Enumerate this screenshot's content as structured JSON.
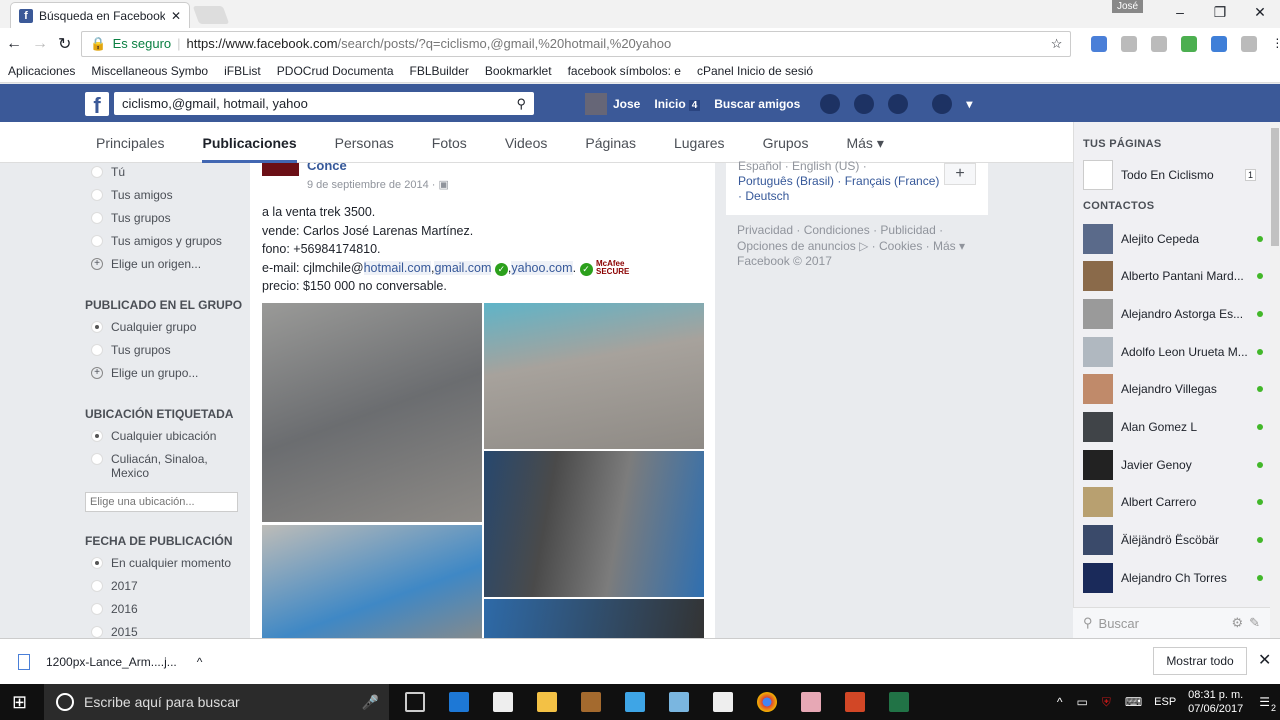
{
  "browser": {
    "tab_title": "Búsqueda en Facebook: c",
    "user": "José",
    "secure_label": "Es seguro",
    "url_host": "https://www.facebook.com",
    "url_path": "/search/posts/?q=ciclismo,@gmail,%20hotmail,%20yahoo",
    "bookmarks": [
      "Aplicaciones",
      "Miscellaneous Symbo",
      "iFBList",
      "PDOCrud Documenta",
      "FBLBuilder",
      "Bookmarklet",
      "facebook símbolos: e",
      "cPanel Inicio de sesió"
    ]
  },
  "fb": {
    "search_value": "ciclismo,@gmail, hotmail, yahoo",
    "user": "Jose",
    "home": "Inicio",
    "home_count": "4",
    "find_friends": "Buscar amigos"
  },
  "tabs": [
    "Principales",
    "Publicaciones",
    "Personas",
    "Fotos",
    "Videos",
    "Páginas",
    "Lugares",
    "Grupos",
    "Más ▾"
  ],
  "filters": {
    "origin_opts": [
      "Tú",
      "Tus amigos",
      "Tus grupos",
      "Tus amigos y grupos"
    ],
    "origin_choose": "Elige un origen...",
    "group_title": "PUBLICADO EN EL GRUPO",
    "group_opts": [
      "Cualquier grupo",
      "Tus grupos"
    ],
    "group_choose": "Elige un grupo...",
    "loc_title": "UBICACIÓN ETIQUETADA",
    "loc_opts": [
      "Cualquier ubicación",
      "Culiacán, Sinaloa, Mexico"
    ],
    "loc_placeholder": "Elige una ubicación...",
    "date_title": "FECHA DE PUBLICACIÓN",
    "date_opts": [
      "En cualquier momento",
      "2017",
      "2016",
      "2015"
    ]
  },
  "post": {
    "author": "Conce",
    "date": "9 de septiembre de 2014 ·",
    "line1": "a la venta trek 3500.",
    "line2": "vende: Carlos José Larenas Martínez.",
    "line3": "fono: +56984174810.",
    "email_prefix": "e-mail: cjlmchile@",
    "email_hotmail": "hotmail.com",
    "email_gmail": "gmail.com",
    "email_yahoo": "yahoo.com",
    "mcafee": "McAfee SECURE",
    "line5": "precio: $150 000 no conversable."
  },
  "languages": {
    "line1": "Español · English (US) ·",
    "line2": "Português (Brasil) · Français (France)",
    "line3": "· Deutsch"
  },
  "footer": {
    "line1": "Privacidad · Condiciones · Publicidad ·",
    "line2": "Opciones de anuncios ▷ · Cookies · Más ▾",
    "line3": "Facebook © 2017"
  },
  "chat": {
    "pages_title": "TUS PÁGINAS",
    "page": "Todo En Ciclismo",
    "page_count": "1",
    "contacts_title": "CONTACTOS",
    "contacts": [
      "Alejito Cepeda",
      "Alberto Pantani Mard...",
      "Alejandro Astorga Es...",
      "Adolfo Leon Urueta M...",
      "Alejandro Villegas",
      "Alan Gomez L",
      "Javier Genoy",
      "Albert Carrero",
      "Älëjändrö Ëscöbär",
      "Alejandro Ch Torres"
    ],
    "search_placeholder": "Buscar"
  },
  "download": {
    "file": "1200px-Lance_Arm....j...",
    "show_all": "Mostrar todo"
  },
  "taskbar": {
    "search": "Escribe aquí para buscar",
    "lang": "ESP",
    "time": "08:31 p. m.",
    "date": "07/06/2017",
    "notif": "2"
  }
}
